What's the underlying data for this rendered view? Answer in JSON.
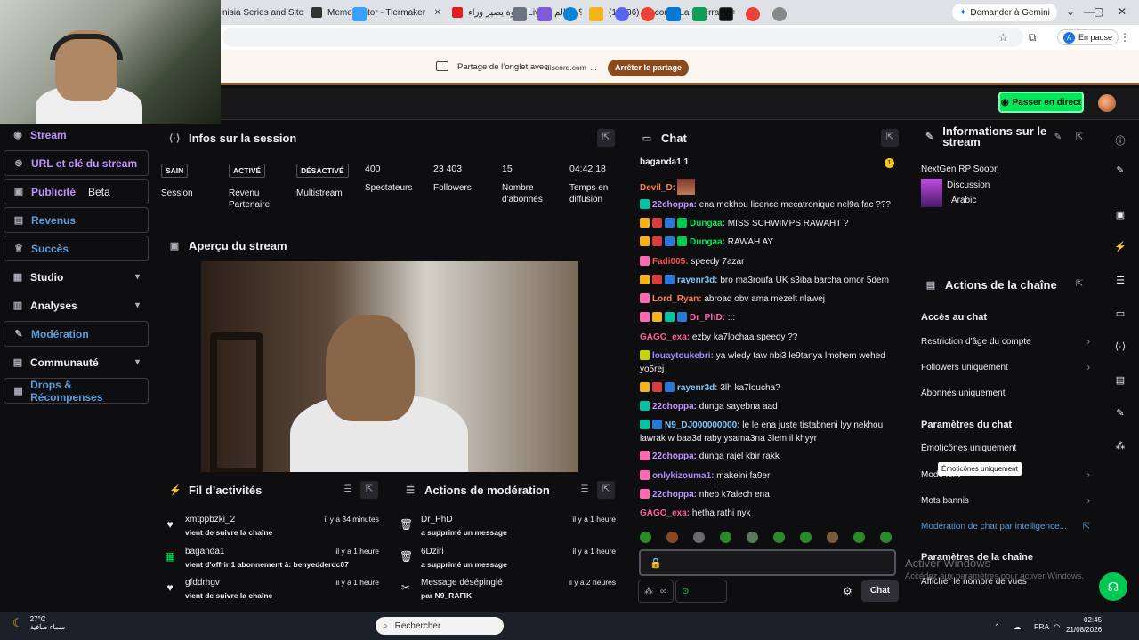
{
  "browser": {
    "tabs": [
      {
        "title": "nisia Series and Sito"
      },
      {
        "title": "Meme Editor - Tiermaker"
      },
      {
        "title": "شتوة يصير وراء Live؟ | عالم الـ"
      },
      {
        "title": "(14936) Discord | La Guerra"
      }
    ],
    "gemini_label": "Demander à Gemini",
    "profile_status": "En pause",
    "profile_initial": "A"
  },
  "sharebar": {
    "text": "Partage de l’onglet avec",
    "site": "discord.com",
    "ellipsis": "...",
    "stop_label": "Arrêter le partage"
  },
  "topbar": {
    "golive_label": "Passer en direct"
  },
  "nav": {
    "items": [
      {
        "label": "Stream"
      },
      {
        "label": "URL et clé du stream"
      },
      {
        "label": "Publicité",
        "badge": "Beta"
      },
      {
        "label": "Revenus"
      },
      {
        "label": "Succès"
      },
      {
        "label": "Studio"
      },
      {
        "label": "Analyses"
      },
      {
        "label": "Modération"
      },
      {
        "label": "Communauté"
      },
      {
        "label": "Drops & Récompenses"
      }
    ]
  },
  "session": {
    "title": "Infos sur la session",
    "stats": [
      {
        "tag": "SAIN",
        "label": "Session"
      },
      {
        "tag": "ACTIVÉ",
        "label": "Revenu Partenaire"
      },
      {
        "tag": "DÉSACTIVÉ",
        "label": "Multistream"
      },
      {
        "value": "400",
        "label": "Spectateurs"
      },
      {
        "value": "23 403",
        "label": "Followers"
      },
      {
        "value": "15",
        "label": "Nombre d'abonnés"
      },
      {
        "value": "04:42:18",
        "label": "Temps en diffusion"
      }
    ]
  },
  "preview": {
    "title": "Aperçu du stream"
  },
  "activity": {
    "title": "Fil d’activités",
    "rows": [
      {
        "who": "xmtppbzki_2",
        "what": "vient de suivre la chaîne",
        "when": "il y a 34 minutes"
      },
      {
        "who": "baganda1",
        "what": "vient d'offrir 1 abonnement à: benyedderdc07",
        "when": "il y a 1 heure"
      },
      {
        "who": "gfddrhgv",
        "what": "vient de suivre la chaîne",
        "when": "il y a 1 heure"
      }
    ]
  },
  "modactions": {
    "title": "Actions de modération",
    "rows": [
      {
        "who": "Dr_PhD",
        "what": "a supprimé un message",
        "when": "il y a 1 heure"
      },
      {
        "who": "6Dziri",
        "what": "a supprimé un message",
        "when": "il y a 1 heure"
      },
      {
        "who": "Message désépinglé",
        "what": "par N9_RAFIK",
        "when": "il y a 2 heures"
      }
    ]
  },
  "chat": {
    "title": "Chat",
    "pinned": "baganda1 1",
    "pinned_count": "1",
    "messages": [
      {
        "user": "Devil_D:",
        "text": "",
        "color": "#ff7f50"
      },
      {
        "user": "22choppa:",
        "text": "ena mekhou licence mecatronique nel9a fac ???",
        "color": "#bf94ff"
      },
      {
        "user": "Dungaa:",
        "text": "MISS SCHWIMPS RAWAHT ?",
        "color": "#00e85a"
      },
      {
        "user": "Dungaa:",
        "text": "RAWAH AY",
        "color": "#00e85a"
      },
      {
        "user": "Fadi005:",
        "text": "speedy 7azar",
        "color": "#ff4d4d"
      },
      {
        "user": "rayenr3d:",
        "text": "bro ma3roufa UK s3iba barcha omor 5dem",
        "color": "#7ec8ff"
      },
      {
        "user": "Lord_Ryan:",
        "text": "abroad obv ama mezelt nlawej",
        "color": "#ff7f50"
      },
      {
        "user": "Dr_PhD:",
        "text": ":::",
        "color": "#ff69b4"
      },
      {
        "user": "GAGO_exa:",
        "text": "ezby ka7lochaa speedy ??",
        "color": "#ff5f9e"
      },
      {
        "user": "louaytoukebri:",
        "text": "ya wledy taw nbi3 le9tanya lmohem wehed yo5rej",
        "color": "#a78bfa"
      },
      {
        "user": "rayenr3d:",
        "text": "3lh ka7loucha?",
        "color": "#7ec8ff"
      },
      {
        "user": "22choppa:",
        "text": "dunga sayebna aad",
        "color": "#bf94ff"
      },
      {
        "user": "N9_DJ000000000:",
        "text": "le le ena juste tistabneni lyy nekhou lawrak w baa3d raby ysama3na 3lem il khyyr",
        "color": "#7ec8ff"
      },
      {
        "user": "22choppa:",
        "text": "dunga rajel kbir rakk",
        "color": "#bf94ff"
      },
      {
        "user": "onlykizouma1:",
        "text": "makelni fa9er",
        "color": "#a78bfa"
      },
      {
        "user": "22choppa:",
        "text": "nheb k7alech ena",
        "color": "#bf94ff"
      },
      {
        "user": "GAGO_exa:",
        "text": "hetha rathi nyk",
        "color": "#ff5f9e"
      }
    ],
    "send_label": "Chat"
  },
  "info": {
    "title": "Informations sur le stream",
    "stream_title": "NextGen RP Sooon",
    "category": "Discussion",
    "language": "Arabic"
  },
  "channel_actions": {
    "title": "Actions de la chaîne",
    "chat_access_head": "Accès au chat",
    "chat_access": [
      {
        "label": "Restriction d'âge du compte",
        "chevron": true
      },
      {
        "label": "Followers uniquement",
        "chevron": true
      },
      {
        "label": "Abonnés uniquement",
        "chevron": false
      }
    ],
    "chat_settings_head": "Paramètres du chat",
    "chat_settings": [
      {
        "label": "Émoticônes uniquement",
        "chevron": false
      },
      {
        "label": "Mode lent",
        "chevron": true
      },
      {
        "label": "Mots bannis",
        "chevron": true
      }
    ],
    "ai_mod_link": "Modération de chat par intelligence...",
    "channel_settings_head": "Paramètres de la chaîne",
    "view_count": "Afficher le nombre de vues",
    "tooltip": "Émoticônes uniquement"
  },
  "watermark": {
    "line1": "Activer Windows",
    "line2": "Accédez aux paramètres pour activer Windows."
  },
  "taskbar": {
    "temp": "27°C",
    "weather": "سماء صافية",
    "search_placeholder": "Rechercher",
    "lang": "FRA",
    "time": "02:45",
    "date": "21/08/2026"
  },
  "colors": {
    "accent": "#bf94ff",
    "go_live": "#00e85a",
    "link": "#5c9ddb"
  }
}
